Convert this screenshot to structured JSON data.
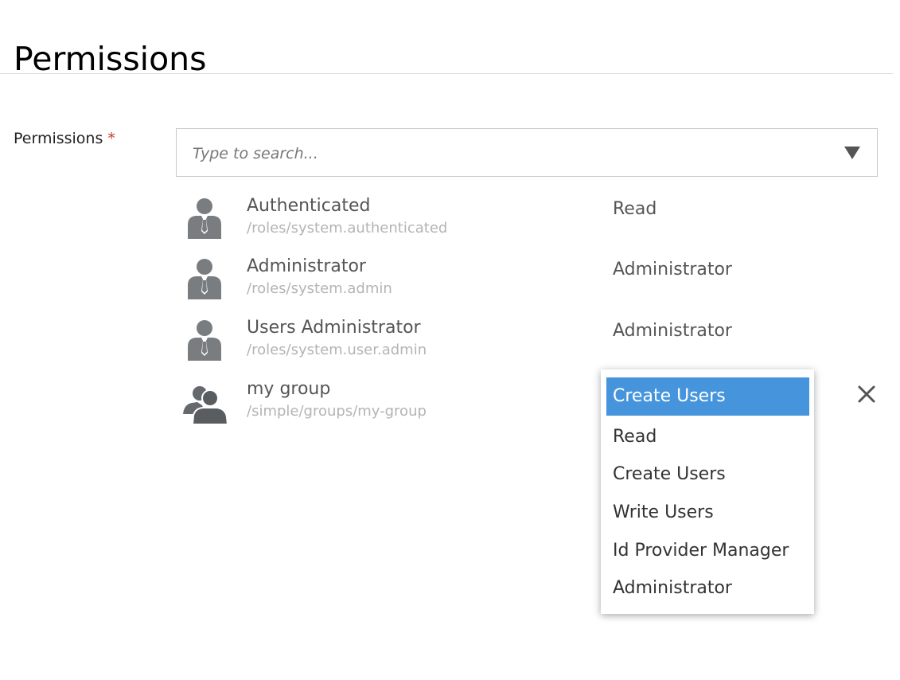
{
  "page": {
    "title": "Permissions"
  },
  "field": {
    "label": "Permissions",
    "required_marker": "*"
  },
  "search": {
    "placeholder": "Type to search..."
  },
  "principals": [
    {
      "name": "Authenticated",
      "path": "/roles/system.authenticated",
      "access": "Read",
      "icon": "user-icon"
    },
    {
      "name": "Administrator",
      "path": "/roles/system.admin",
      "access": "Administrator",
      "icon": "user-icon"
    },
    {
      "name": "Users Administrator",
      "path": "/roles/system.user.admin",
      "access": "Administrator",
      "icon": "user-icon"
    },
    {
      "name": "my group",
      "path": "/simple/groups/my-group",
      "access": "Create Users",
      "icon": "group-icon"
    }
  ],
  "access_menu": {
    "selected": "Create Users",
    "options": [
      "Read",
      "Create Users",
      "Write Users",
      "Id Provider Manager",
      "Administrator"
    ]
  },
  "colors": {
    "highlight": "#4695dc",
    "icon": "#7a7d80",
    "required": "#c0392b"
  }
}
